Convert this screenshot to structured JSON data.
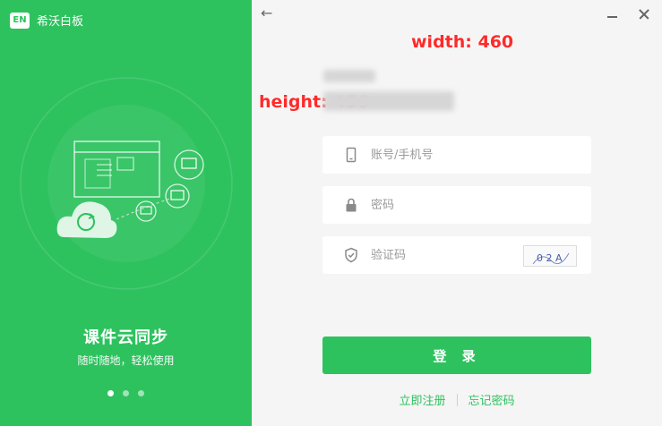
{
  "brand": {
    "logo_text": "EN",
    "name": "希沃白板"
  },
  "left_panel": {
    "title": "课件云同步",
    "subtitle": "随时随地，轻松使用",
    "carousel": {
      "count": 3,
      "active_index": 0
    }
  },
  "annotations": {
    "width": "width: 460",
    "height": "height: 450"
  },
  "form": {
    "account_placeholder": "账号/手机号",
    "password_placeholder": "密码",
    "captcha_placeholder": "验证码",
    "captcha_text": "0 2 A",
    "login_label": "登 录"
  },
  "links": {
    "register": "立即注册",
    "forgot": "忘记密码"
  },
  "colors": {
    "accent": "#2ec25f",
    "panel_bg": "#f5f5f5"
  },
  "icons": {
    "back": "arrow-left-icon",
    "minimize": "minimize-icon",
    "close": "close-icon",
    "phone": "phone-icon",
    "lock": "lock-icon",
    "shield": "shield-check-icon"
  }
}
